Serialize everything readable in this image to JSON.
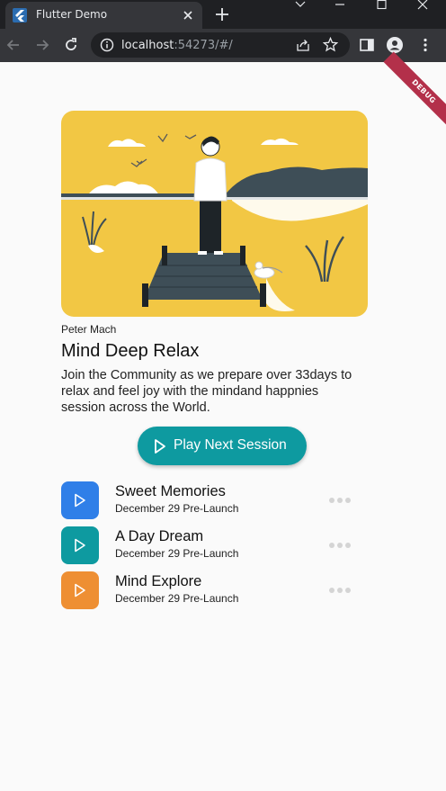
{
  "browser": {
    "tab_title": "Flutter Demo",
    "url_host": "localhost",
    "url_rest": ":54273/#/"
  },
  "debug_banner": "DEBUG",
  "hero": {
    "author": "Peter Mach",
    "title": "Mind Deep Relax",
    "description": "Join the Community as we prepare over 33days to relax and feel joy with the mindand happnies session across the World."
  },
  "play_button": "Play Next Session",
  "tracks": [
    {
      "title": "Sweet Memories",
      "subtitle": "December 29 Pre-Launch",
      "color": "#2f7fe8"
    },
    {
      "title": "A Day Dream",
      "subtitle": "December 29 Pre-Launch",
      "color": "#0e9aa0"
    },
    {
      "title": "Mind Explore",
      "subtitle": "December 29 Pre-Launch",
      "color": "#ee8f33"
    }
  ],
  "colors": {
    "illustration_bg": "#f2c744",
    "accent": "#0e9aa0"
  }
}
